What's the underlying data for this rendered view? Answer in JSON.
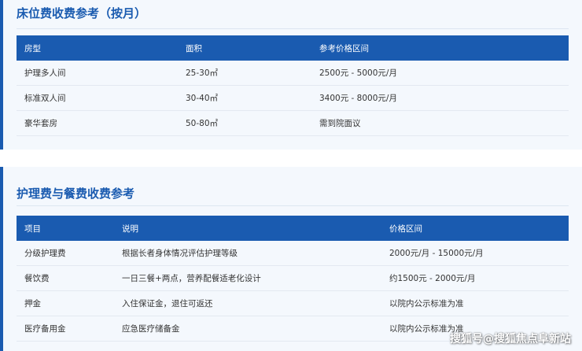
{
  "section1": {
    "title": "床位费收费参考（按月）",
    "headers": [
      "房型",
      "面积",
      "参考价格区间"
    ],
    "rows": [
      [
        "护理多人间",
        "25-30㎡",
        "2500元 - 5000元/月"
      ],
      [
        "标准双人间",
        "30-40㎡",
        "3400元 - 8000元/月"
      ],
      [
        "豪华套房",
        "50-80㎡",
        "需到院面议"
      ]
    ]
  },
  "section2": {
    "title": "护理费与餐费收费参考",
    "headers": [
      "项目",
      "说明",
      "价格区间"
    ],
    "rows": [
      [
        "分级护理费",
        "根据长者身体情况评估护理等级",
        "2000元/月 - 15000元/月"
      ],
      [
        "餐饮费",
        "一日三餐+两点，营养配餐适老化设计",
        "约1500元 - 2000元/月"
      ],
      [
        "押金",
        "入住保证金，退住可返还",
        "以院内公示标准为准"
      ],
      [
        "医疗备用金",
        "应急医疗储备金",
        "以院内公示标准为准"
      ]
    ]
  },
  "watermark": "搜狐号@搜狐焦点阜新站",
  "colors": {
    "accent": "#1a5bb0",
    "panel_bg": "#f4f8fd"
  }
}
